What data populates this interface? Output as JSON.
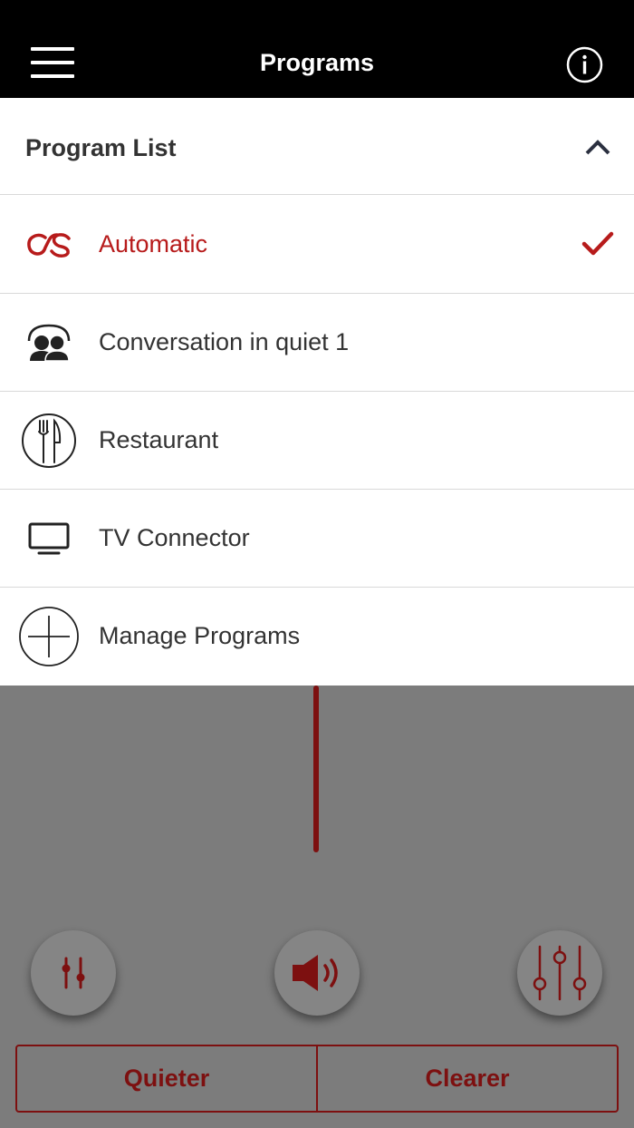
{
  "header": {
    "title": "Programs",
    "menu_icon": "hamburger-menu-icon",
    "info_icon": "info-icon"
  },
  "program_list": {
    "title": "Program List",
    "collapse_icon": "chevron-up-icon",
    "items": [
      {
        "label": "Automatic",
        "icon": "automatic-icon",
        "selected": true
      },
      {
        "label": "Conversation in quiet 1",
        "icon": "conversation-icon",
        "selected": false
      },
      {
        "label": "Restaurant",
        "icon": "restaurant-icon",
        "selected": false
      },
      {
        "label": "TV Connector",
        "icon": "tv-icon",
        "selected": false
      },
      {
        "label": "Manage Programs",
        "icon": "plus-icon",
        "selected": false
      }
    ]
  },
  "controls": {
    "left_icon": "adjust-sliders-icon",
    "center_icon": "speaker-volume-icon",
    "right_icon": "equalizer-icon"
  },
  "bottom_buttons": {
    "quieter": "Quieter",
    "clearer": "Clearer"
  },
  "colors": {
    "accent": "#b71b1b",
    "dark_red": "#7d1010",
    "header_bg": "#000000",
    "overlay_bg": "#7c7c7c"
  }
}
